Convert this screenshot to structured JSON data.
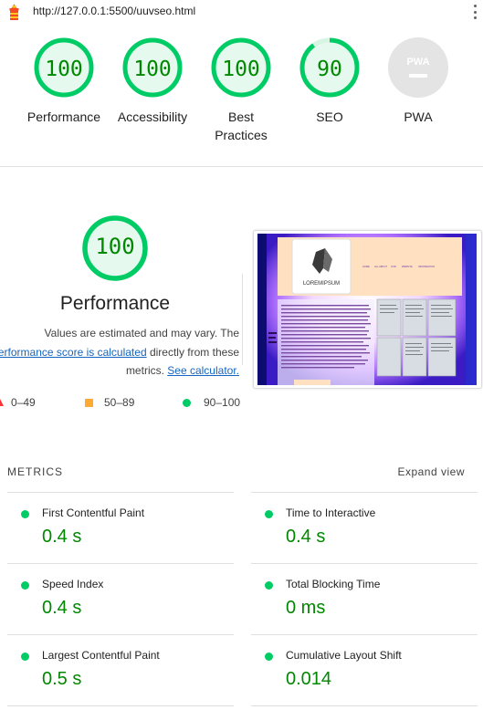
{
  "url": "http://127.0.0.1:5500/uuvseo.html",
  "colors": {
    "pass": "#00cc66",
    "pass_text": "#008800",
    "average": "#ffaa33",
    "fail": "#ff3333",
    "link": "#1565c0"
  },
  "gauges": [
    {
      "label": "Performance",
      "score": "100",
      "value": 1.0
    },
    {
      "label": "Accessibility",
      "score": "100",
      "value": 1.0
    },
    {
      "label": "Best Practices",
      "score": "100",
      "value": 1.0
    },
    {
      "label": "SEO",
      "score": "90",
      "value": 0.9
    },
    {
      "label": "PWA",
      "score": "",
      "icon": "pwa-icon"
    }
  ],
  "category": {
    "score": "100",
    "title": "Performance",
    "desc_prefix": "Values are estimated and may vary. The ",
    "desc_link": "erformance score is calculated",
    "desc_mid": " directly from these metrics. ",
    "calc_link": "See calculator."
  },
  "screenshot": {
    "logo_text": "LOREMIPSUM",
    "nav": [
      "HOME",
      "ALL ABOUT",
      "OUR",
      "WEBSITE",
      "INFORMATION"
    ]
  },
  "legend": [
    {
      "range": "0–49",
      "shape": "triangle"
    },
    {
      "range": "50–89",
      "shape": "square"
    },
    {
      "range": "90–100",
      "shape": "circle"
    }
  ],
  "metrics_header": "METRICS",
  "expand_view": "Expand view",
  "metrics": [
    {
      "title": "First Contentful Paint",
      "value": "0.4 s"
    },
    {
      "title": "Time to Interactive",
      "value": "0.4 s"
    },
    {
      "title": "Speed Index",
      "value": "0.4 s"
    },
    {
      "title": "Total Blocking Time",
      "value": "0 ms"
    },
    {
      "title": "Largest Contentful Paint",
      "value": "0.5 s"
    },
    {
      "title": "Cumulative Layout Shift",
      "value": "0.014"
    }
  ]
}
